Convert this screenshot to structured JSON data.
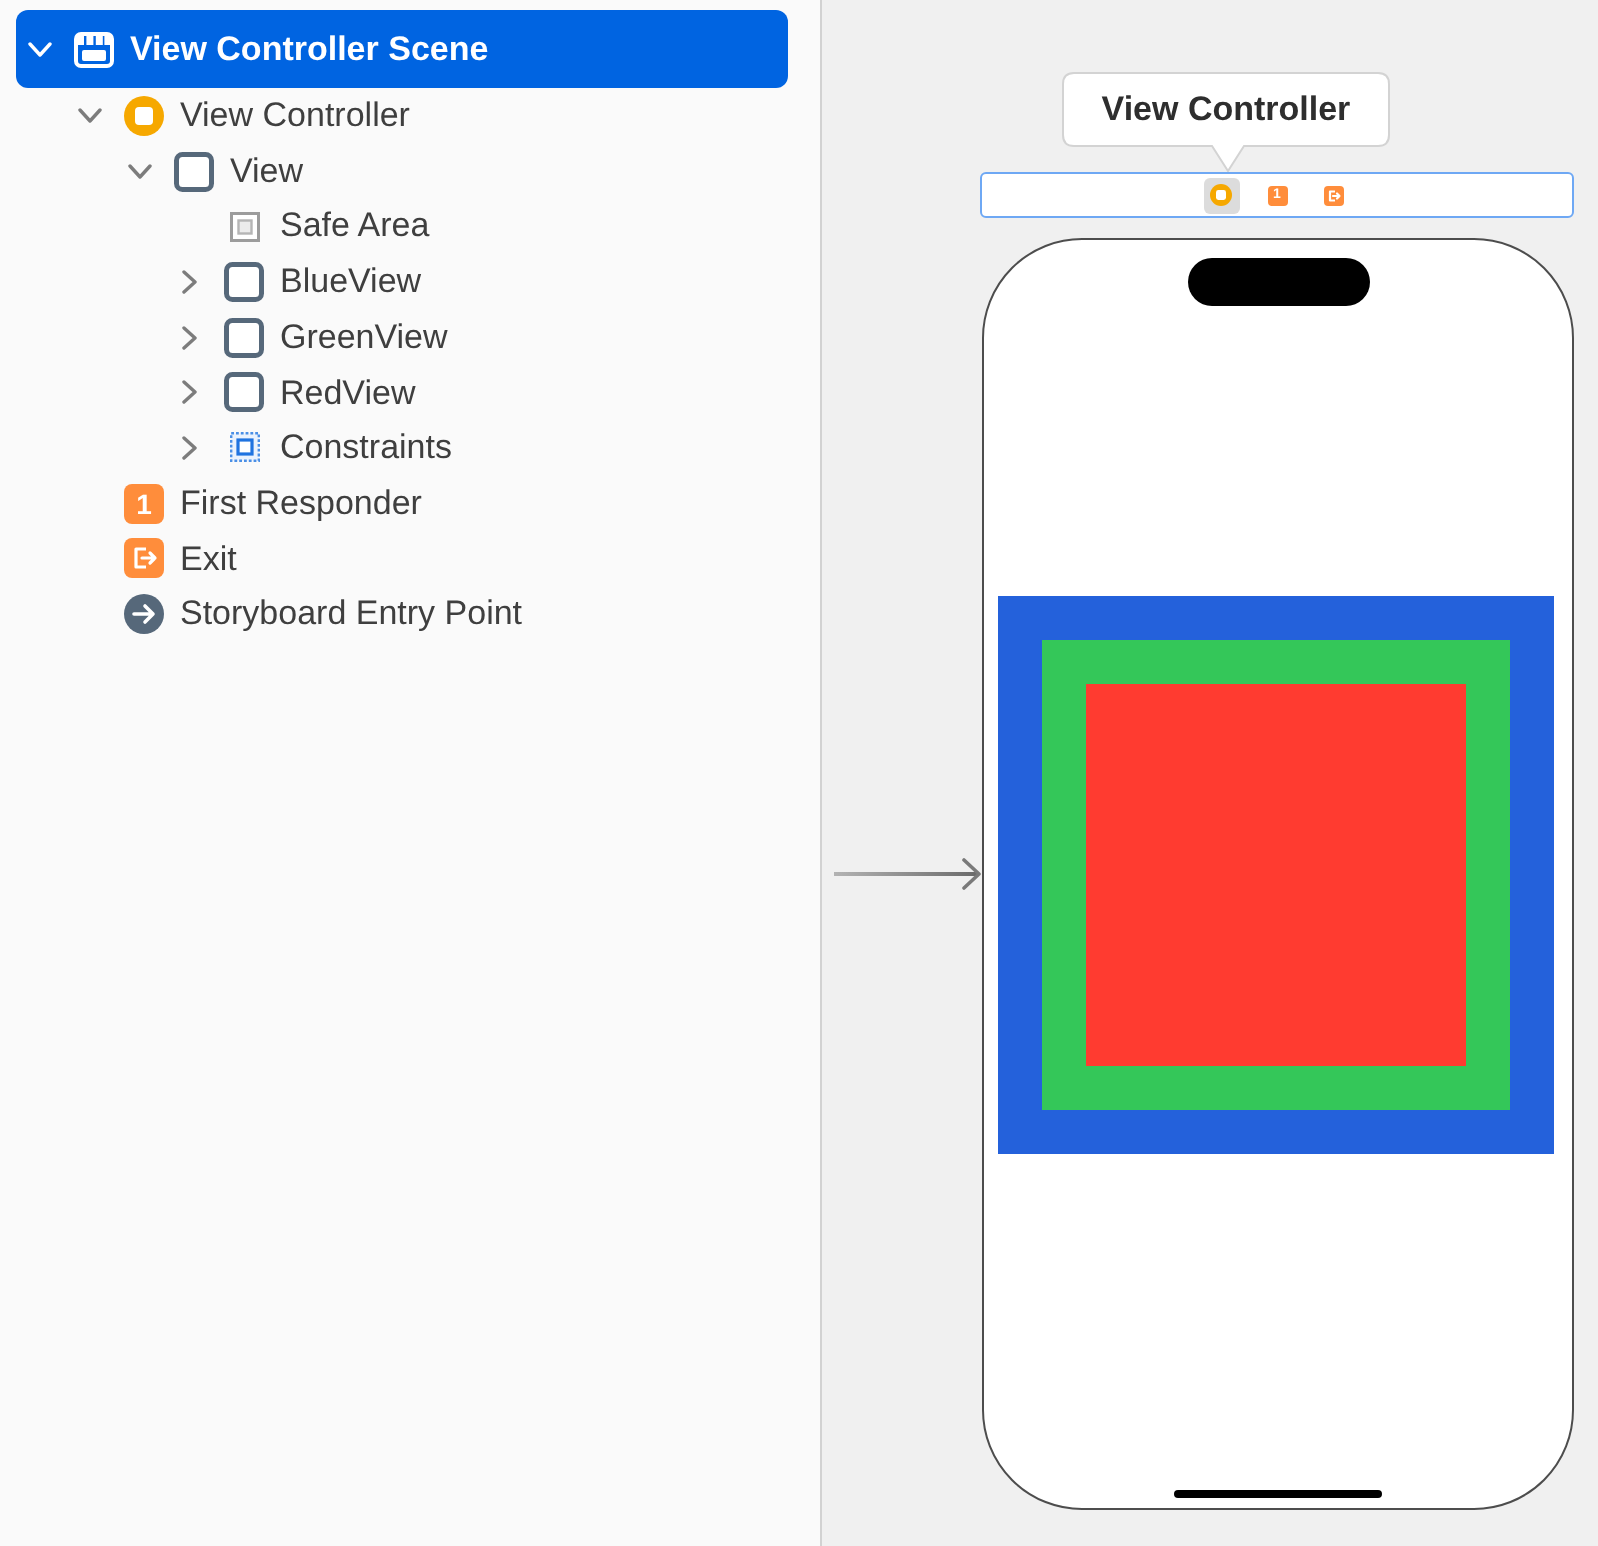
{
  "outline": {
    "items": [
      {
        "kind": "scene",
        "label": "View Controller Scene",
        "selected": true,
        "expanded": true,
        "children": [
          {
            "kind": "view_controller",
            "label": "View Controller",
            "selected": false,
            "expanded": true,
            "children": [
              {
                "kind": "view",
                "label": "View",
                "selected": false,
                "expanded": true,
                "children": [
                  {
                    "kind": "safe_area",
                    "label": "Safe Area",
                    "selected": false
                  },
                  {
                    "kind": "view",
                    "label": "BlueView",
                    "selected": false,
                    "expanded": false
                  },
                  {
                    "kind": "view",
                    "label": "GreenView",
                    "selected": false,
                    "expanded": false
                  },
                  {
                    "kind": "view",
                    "label": "RedView",
                    "selected": false,
                    "expanded": false
                  },
                  {
                    "kind": "constraints",
                    "label": "Constraints",
                    "selected": false,
                    "expanded": false
                  }
                ]
              }
            ]
          },
          {
            "kind": "first_responder",
            "label": "First Responder",
            "selected": false,
            "glyph": "1"
          },
          {
            "kind": "exit",
            "label": "Exit",
            "selected": false
          },
          {
            "kind": "entry_point",
            "label": "Storyboard Entry Point",
            "selected": false
          }
        ]
      }
    ]
  },
  "canvas": {
    "tooltip": "View Controller",
    "scene_dock": [
      {
        "kind": "view_controller",
        "selected": true
      },
      {
        "kind": "first_responder",
        "selected": false,
        "glyph": "1"
      },
      {
        "kind": "exit",
        "selected": false
      }
    ],
    "device": {
      "views": [
        {
          "color": "#2461db",
          "children": [
            {
              "color": "#34c759",
              "children": [
                {
                  "color": "#ff3b30"
                }
              ]
            }
          ]
        }
      ]
    }
  }
}
